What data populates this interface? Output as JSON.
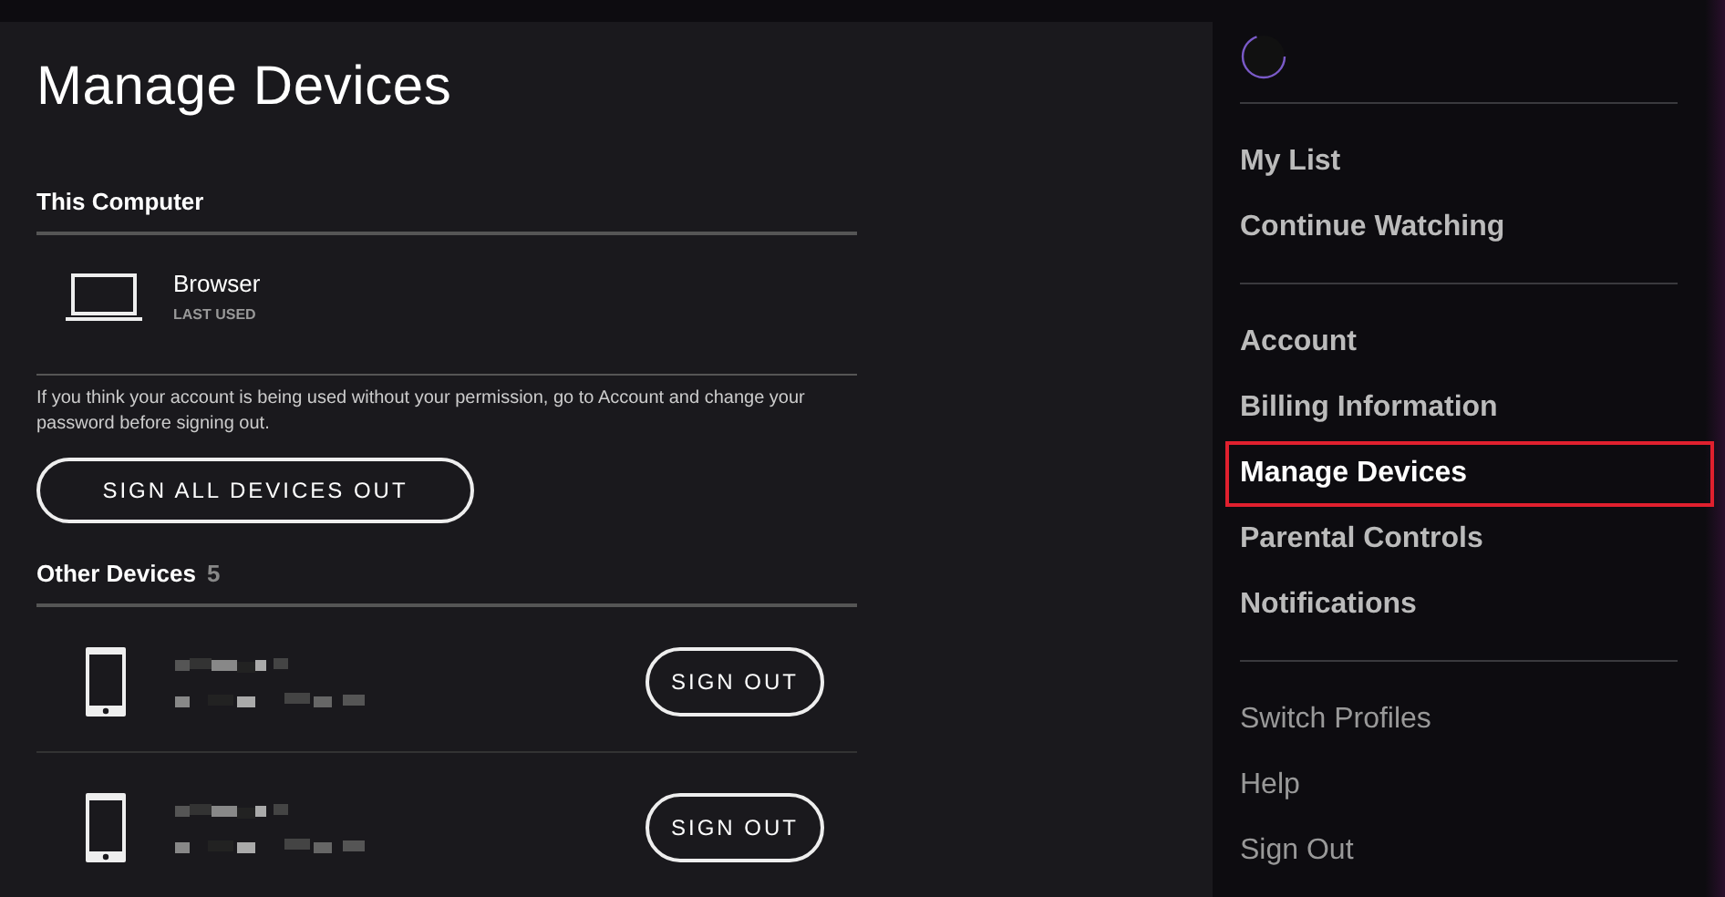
{
  "page": {
    "title": "Manage Devices"
  },
  "this_computer": {
    "heading": "This Computer",
    "device": {
      "kind": "laptop",
      "name": "Browser",
      "meta": "LAST USED"
    },
    "notice": "If you think your account is being used without your permission, go to Account and change your password before signing out.",
    "button": "SIGN ALL DEVICES OUT"
  },
  "other_devices": {
    "heading": "Other Devices",
    "count": "5",
    "devices": [
      {
        "kind": "phone",
        "name_redacted": true,
        "button": "SIGN OUT"
      },
      {
        "kind": "phone",
        "name_redacted": true,
        "button": "SIGN OUT"
      }
    ]
  },
  "sidebar": {
    "groups": [
      {
        "kind": "bold",
        "items": [
          {
            "label": "My List",
            "selected": false,
            "highlighted": false
          },
          {
            "label": "Continue Watching",
            "selected": false,
            "highlighted": false
          }
        ]
      },
      {
        "kind": "bold",
        "items": [
          {
            "label": "Account",
            "selected": false,
            "highlighted": false
          },
          {
            "label": "Billing Information",
            "selected": false,
            "highlighted": false
          },
          {
            "label": "Manage Devices",
            "selected": true,
            "highlighted": true
          },
          {
            "label": "Parental Controls",
            "selected": false,
            "highlighted": false
          },
          {
            "label": "Notifications",
            "selected": false,
            "highlighted": false
          }
        ]
      },
      {
        "kind": "light",
        "items": [
          {
            "label": "Switch Profiles",
            "selected": false,
            "highlighted": false
          },
          {
            "label": "Help",
            "selected": false,
            "highlighted": false
          },
          {
            "label": "Sign Out",
            "selected": false,
            "highlighted": false
          }
        ]
      }
    ]
  }
}
